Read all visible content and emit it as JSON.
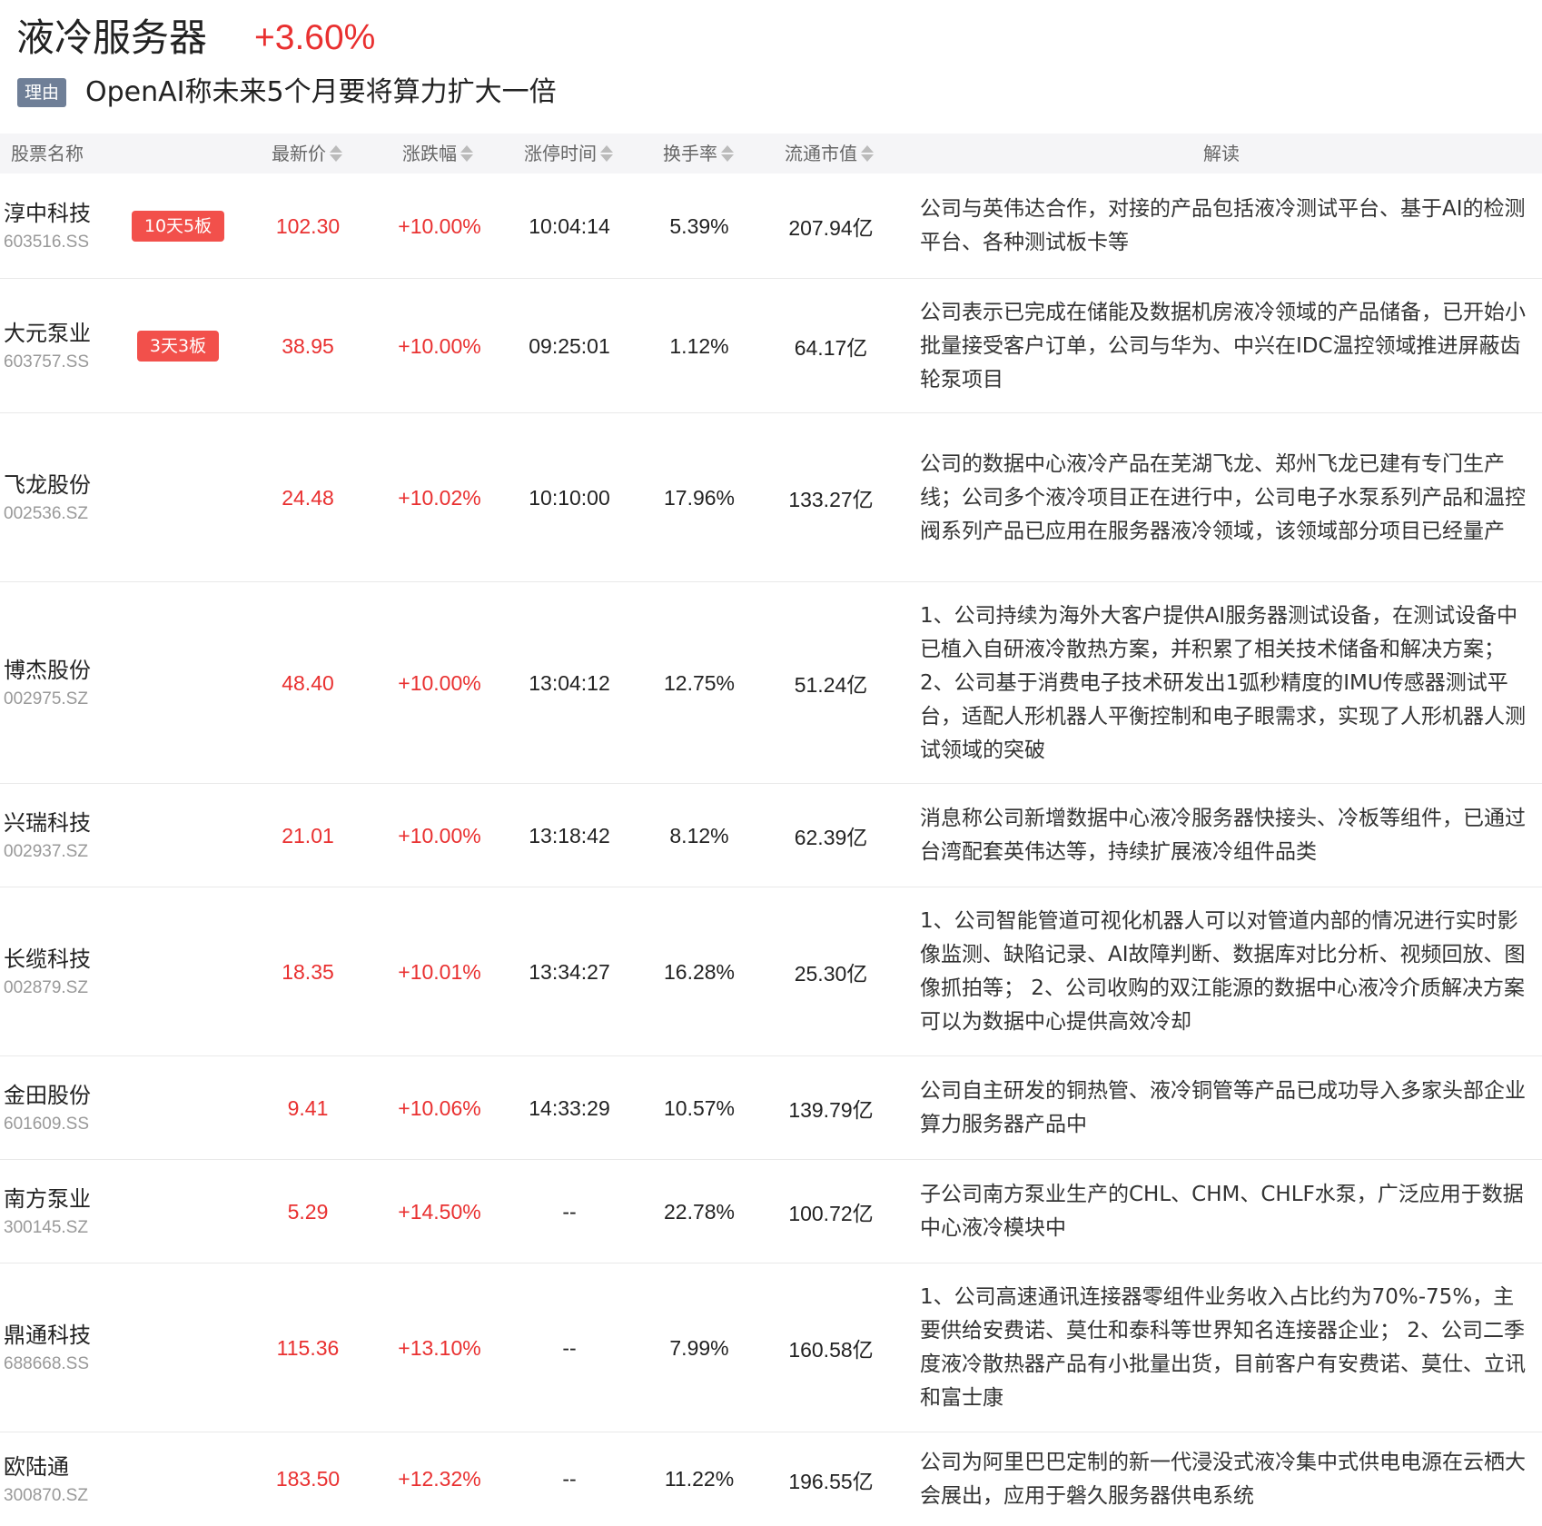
{
  "header": {
    "title": "液冷服务器",
    "change": "+3.60%",
    "reason_tag": "理由",
    "reason_text": "OpenAI称未来5个月要将算力扩大一倍"
  },
  "columns": {
    "name": "股票名称",
    "price": "最新价",
    "pct": "涨跌幅",
    "limit_time": "涨停时间",
    "turnover": "换手率",
    "float_cap": "流通市值",
    "desc": "解读"
  },
  "colors": {
    "up": "#e93030",
    "badge": "#f2504b",
    "tag": "#6f7f97",
    "header_bg": "#f5f5f7"
  },
  "rows": [
    {
      "name": "淳中科技",
      "code": "603516.SS",
      "badge": "10天5板",
      "price": "102.30",
      "pct": "+10.00%",
      "time": "10:04:14",
      "turnover": "5.39%",
      "cap": "207.94亿",
      "desc": "公司与英伟达合作，对接的产品包括液冷测试平台、基于AI的检测平台、各种测试板卡等"
    },
    {
      "name": "大元泵业",
      "code": "603757.SS",
      "badge": "3天3板",
      "price": "38.95",
      "pct": "+10.00%",
      "time": "09:25:01",
      "turnover": "1.12%",
      "cap": "64.17亿",
      "desc": "公司表示已完成在储能及数据机房液冷领域的产品储备，已开始小批量接受客户订单，公司与华为、中兴在IDC温控领域推进屏蔽齿轮泵项目"
    },
    {
      "name": "飞龙股份",
      "code": "002536.SZ",
      "badge": "",
      "price": "24.48",
      "pct": "+10.02%",
      "time": "10:10:00",
      "turnover": "17.96%",
      "cap": "133.27亿",
      "desc": "公司的数据中心液冷产品在芜湖飞龙、郑州飞龙已建有专门生产线；公司多个液冷项目正在进行中，公司电子水泵系列产品和温控阀系列产品已应用在服务器液冷领域，该领域部分项目已经量产"
    },
    {
      "name": "博杰股份",
      "code": "002975.SZ",
      "badge": "",
      "price": "48.40",
      "pct": "+10.00%",
      "time": "13:04:12",
      "turnover": "12.75%",
      "cap": "51.24亿",
      "desc": "1、公司持续为海外大客户提供AI服务器测试设备，在测试设备中已植入自研液冷散热方案，并积累了相关技术储备和解决方案；2、公司基于消费电子技术研发出1弧秒精度的IMU传感器测试平台，适配人形机器人平衡控制和电子眼需求，实现了人形机器人测试领域的突破"
    },
    {
      "name": "兴瑞科技",
      "code": "002937.SZ",
      "badge": "",
      "price": "21.01",
      "pct": "+10.00%",
      "time": "13:18:42",
      "turnover": "8.12%",
      "cap": "62.39亿",
      "desc": "消息称公司新增数据中心液冷服务器快接头、冷板等组件，已通过台湾配套英伟达等，持续扩展液冷组件品类"
    },
    {
      "name": "长缆科技",
      "code": "002879.SZ",
      "badge": "",
      "price": "18.35",
      "pct": "+10.01%",
      "time": "13:34:27",
      "turnover": "16.28%",
      "cap": "25.30亿",
      "desc": "1、公司智能管道可视化机器人可以对管道内部的情况进行实时影像监测、缺陷记录、AI故障判断、数据库对比分析、视频回放、图像抓拍等； 2、公司收购的双江能源的数据中心液冷介质解决方案可以为数据中心提供高效冷却"
    },
    {
      "name": "金田股份",
      "code": "601609.SS",
      "badge": "",
      "price": "9.41",
      "pct": "+10.06%",
      "time": "14:33:29",
      "turnover": "10.57%",
      "cap": "139.79亿",
      "desc": "公司自主研发的铜热管、液冷铜管等产品已成功导入多家头部企业算力服务器产品中"
    },
    {
      "name": "南方泵业",
      "code": "300145.SZ",
      "badge": "",
      "price": "5.29",
      "pct": "+14.50%",
      "time": "--",
      "turnover": "22.78%",
      "cap": "100.72亿",
      "desc": "子公司南方泵业生产的CHL、CHM、CHLF水泵，广泛应用于数据中心液冷模块中"
    },
    {
      "name": "鼎通科技",
      "code": "688668.SS",
      "badge": "",
      "price": "115.36",
      "pct": "+13.10%",
      "time": "--",
      "turnover": "7.99%",
      "cap": "160.58亿",
      "desc": "1、公司高速通讯连接器零组件业务收入占比约为70%-75%，主要供给安费诺、莫仕和泰科等世界知名连接器企业； 2、公司二季度液冷散热器产品有小批量出货，目前客户有安费诺、莫仕、立讯和富士康"
    },
    {
      "name": "欧陆通",
      "code": "300870.SZ",
      "badge": "",
      "price": "183.50",
      "pct": "+12.32%",
      "time": "--",
      "turnover": "11.22%",
      "cap": "196.55亿",
      "desc": "公司为阿里巴巴定制的新一代浸没式液冷集中式供电电源在云栖大会展出，应用于磐久服务器供电系统"
    }
  ]
}
